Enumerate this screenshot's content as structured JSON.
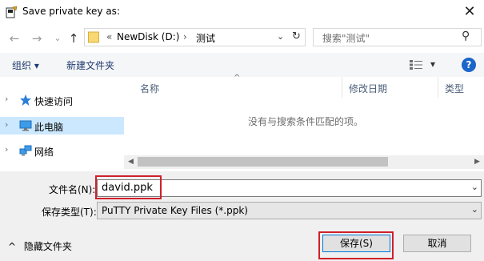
{
  "dialog": {
    "title": "Save private key as:",
    "close_glyph": "✕"
  },
  "nav": {
    "back_glyph": "←",
    "forward_glyph": "→",
    "recent_glyph": "⌄",
    "up_glyph": "↑",
    "breadcrumb_prefix": "«",
    "breadcrumb": [
      "NewDisk (D:)",
      "测试"
    ],
    "breadcrumb_sep": "›",
    "address_dropdown_glyph": "⌄",
    "refresh_glyph": "↻",
    "search_placeholder": "搜索\"测试\"",
    "search_glyph": "⚲"
  },
  "toolbar": {
    "organize_label": "组织 ▾",
    "new_folder_label": "新建文件夹",
    "view_dropdown_glyph": "▾",
    "help_glyph": "?"
  },
  "sidebar": {
    "items": [
      {
        "label": "快速访问",
        "icon": "star-icon",
        "selected": false
      },
      {
        "label": "此电脑",
        "icon": "computer-icon",
        "selected": true
      },
      {
        "label": "网络",
        "icon": "network-icon",
        "selected": false
      }
    ],
    "expand_glyph": "›"
  },
  "filelist": {
    "columns": [
      "名称",
      "修改日期",
      "类型"
    ],
    "sort_glyph": "^",
    "empty_message": "没有与搜索条件匹配的项。"
  },
  "form": {
    "filename_label": "文件名(N):",
    "filename_value": "david.ppk",
    "filetype_label": "保存类型(T):",
    "filetype_value": "PuTTY Private Key Files (*.ppk)",
    "dropdown_glyph": "⌄"
  },
  "footer": {
    "hide_folders_label": "隐藏文件夹",
    "hide_folders_glyph": "^",
    "save_label": "保存(S)",
    "cancel_label": "取消"
  },
  "colors": {
    "selection": "#cce8ff",
    "highlight_red": "#d0202a",
    "accent_blue": "#0078d7",
    "help_blue": "#1b66c9"
  }
}
